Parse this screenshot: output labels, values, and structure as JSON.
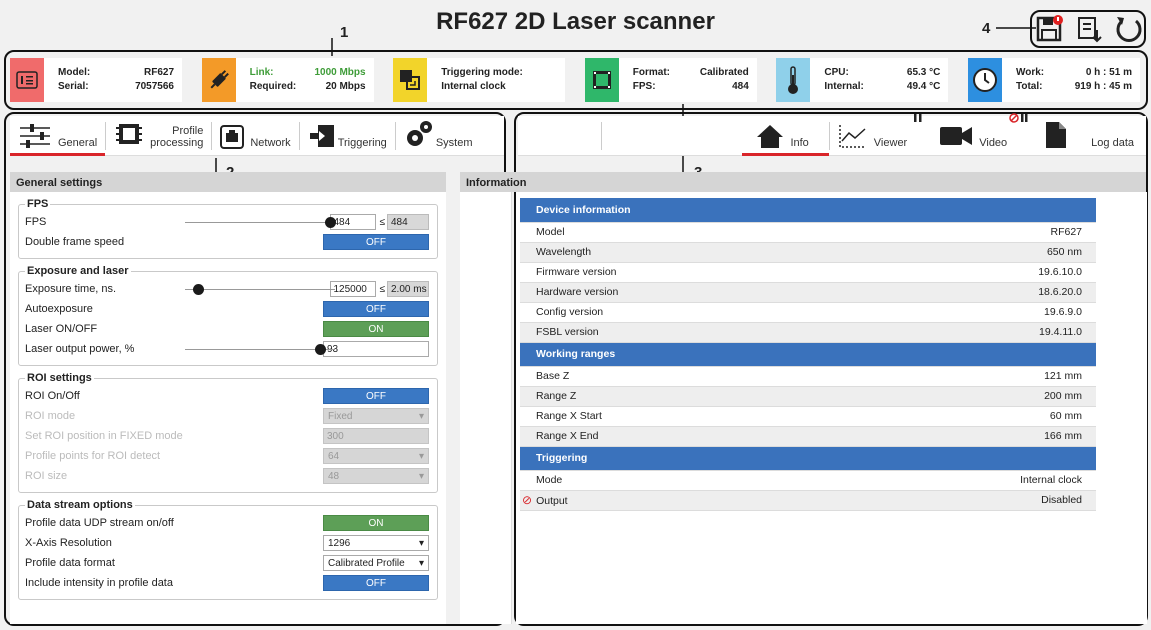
{
  "title": "RF627 2D Laser scanner",
  "callouts": [
    "1",
    "2",
    "3",
    "4"
  ],
  "top_actions": [
    "save-icon",
    "export-icon",
    "refresh-icon"
  ],
  "status": {
    "model_label": "Model:",
    "model_value": "RF627",
    "serial_label": "Serial:",
    "serial_value": "7057566",
    "link_label": "Link:",
    "link_value": "1000 Mbps",
    "required_label": "Required:",
    "required_value": "20 Mbps",
    "trig_label": "Triggering mode:",
    "trig_value": "Internal clock",
    "format_label": "Format:",
    "format_value": "Calibrated",
    "fps_label": "FPS:",
    "fps_value": "484",
    "cpu_label": "CPU:",
    "cpu_value": "65.3 °C",
    "internal_label": "Internal:",
    "internal_value": "49.4 °C",
    "work_label": "Work:",
    "work_value": "0 h : 51 m",
    "total_label": "Total:",
    "total_value": "919 h : 45 m",
    "colors": {
      "model": "#f06b6b",
      "link": "#f39a28",
      "trigger": "#f2d42a",
      "format": "#2fb76a",
      "cpu": "#8fd0ea",
      "work": "#2d8fe0"
    }
  },
  "left_tabs": {
    "general": "General",
    "profile1": "Profile",
    "profile2": "processing",
    "network": "Network",
    "triggering": "Triggering",
    "system": "System"
  },
  "right_tabs": {
    "info": "Info",
    "viewer": "Viewer",
    "video": "Video",
    "log": "Log data"
  },
  "general": {
    "header": "General settings",
    "fps_group": "FPS",
    "fps_label": "FPS",
    "fps_value": "484",
    "fps_max": "≤",
    "fps_max_value": "484",
    "fps_level": 1.0,
    "double_label": "Double frame speed",
    "double_value": "OFF",
    "exp_group": "Exposure and laser",
    "exp_label": "Exposure time, ns.",
    "exp_value": "125000",
    "exp_max": "≤",
    "exp_max_value": "2.00 ms",
    "exp_level": 0.06,
    "auto_label": "Autoexposure",
    "auto_value": "OFF",
    "laser_label": "Laser ON/OFF",
    "laser_value": "ON",
    "power_label": "Laser output power, %",
    "power_value": "93",
    "power_level": 0.93,
    "roi_group": "ROI settings",
    "roi_label": "ROI On/Off",
    "roi_value": "OFF",
    "roimode_label": "ROI mode",
    "roimode_value": "Fixed",
    "roipos_label": "Set ROI position in FIXED mode",
    "roipos_value": "300",
    "roipts_label": "Profile points for ROI detect",
    "roipts_value": "64",
    "roisize_label": "ROI size",
    "roisize_value": "48",
    "ds_group": "Data stream options",
    "udp_label": "Profile data UDP stream on/off",
    "udp_value": "ON",
    "xres_label": "X-Axis Resolution",
    "xres_value": "1296",
    "fmt_label": "Profile data format",
    "fmt_value": "Calibrated Profile",
    "int_label": "Include intensity in profile data",
    "int_value": "OFF"
  },
  "info": {
    "header": "Information",
    "device_header": "Device information",
    "device": [
      {
        "k": "Model",
        "v": "RF627"
      },
      {
        "k": "Wavelength",
        "v": "650 nm"
      },
      {
        "k": "Firmware version",
        "v": "19.6.10.0"
      },
      {
        "k": "Hardware version",
        "v": "18.6.20.0"
      },
      {
        "k": "Config version",
        "v": "19.6.9.0"
      },
      {
        "k": "FSBL version",
        "v": "19.4.11.0"
      }
    ],
    "ranges_header": "Working ranges",
    "ranges": [
      {
        "k": "Base Z",
        "v": "121 mm"
      },
      {
        "k": "Range Z",
        "v": "200 mm"
      },
      {
        "k": "Range X Start",
        "v": "60 mm"
      },
      {
        "k": "Range X End",
        "v": "166 mm"
      }
    ],
    "trig_header": "Triggering",
    "trig": [
      {
        "k": "Mode",
        "v": "Internal clock"
      },
      {
        "k": "Output",
        "v": "Disabled"
      }
    ]
  }
}
